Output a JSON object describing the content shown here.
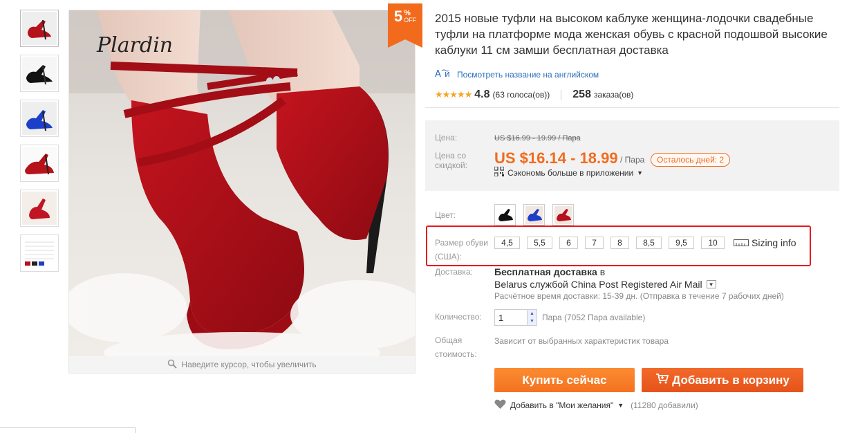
{
  "colors": {
    "accent": "#f26b1d",
    "link": "#2a6ebb",
    "highlight": "#e5191c"
  },
  "badge": {
    "number": "5",
    "percent": "%",
    "off": "OFF"
  },
  "gallery": {
    "thumbnails": [
      "red-shoe",
      "black-shoe",
      "blue-shoe",
      "red-shoe-side",
      "red-shoe-top",
      "size-chart"
    ],
    "watermark": "Plardin",
    "zoom_hint": "Наведите курсор, чтобы увеличить"
  },
  "product": {
    "title": "2015 новые туфли на высоком каблуке женщина-лодочки свадебные туфли на платформе мода женская обувь с красной подошвой высокие каблуки 11 см замши бесплатная доставка",
    "translate_link": "Посмотреть название на английском",
    "rating_score": "4.8",
    "rating_votes": "(63 голоса(ов))",
    "orders_count": "258",
    "orders_label": "заказа(ов)"
  },
  "price": {
    "label": "Цена:",
    "old": "US $16.99 - 19.99 / Пара",
    "discount_label": "Цена со скидкой:",
    "new": "US $16.14 - 18.99",
    "unit": "/ Пара",
    "days_left": "Осталось дней: 2",
    "app_save": "Сэкономь больше в приложении"
  },
  "options": {
    "color_label": "Цвет:",
    "size_label": "Размер обуви (США):",
    "sizes": [
      "4,5",
      "5,5",
      "6",
      "7",
      "8",
      "8,5",
      "9,5",
      "10"
    ],
    "sizing_info": "Sizing info"
  },
  "shipping": {
    "label": "Доставка:",
    "title": "Бесплатная доставка",
    "title_suffix": "в",
    "method": "Belarus службой China Post Registered Air Mail",
    "estimate": "Расчётное время доставки: 15-39 дн. (Отправка в течение 7 рабочих дней)"
  },
  "quantity": {
    "label": "Количество:",
    "value": "1",
    "note": "Пара (7052 Пара available)"
  },
  "total": {
    "label_line1": "Общая",
    "label_line2": "стоимость:",
    "note": "Зависит от выбранных характеристик товара"
  },
  "actions": {
    "buy_now": "Купить сейчас",
    "add_to_cart": "Добавить в корзину",
    "wishlist": "Добавить в \"Мои желания\"",
    "wishlist_count": "(11280 добавили)"
  }
}
